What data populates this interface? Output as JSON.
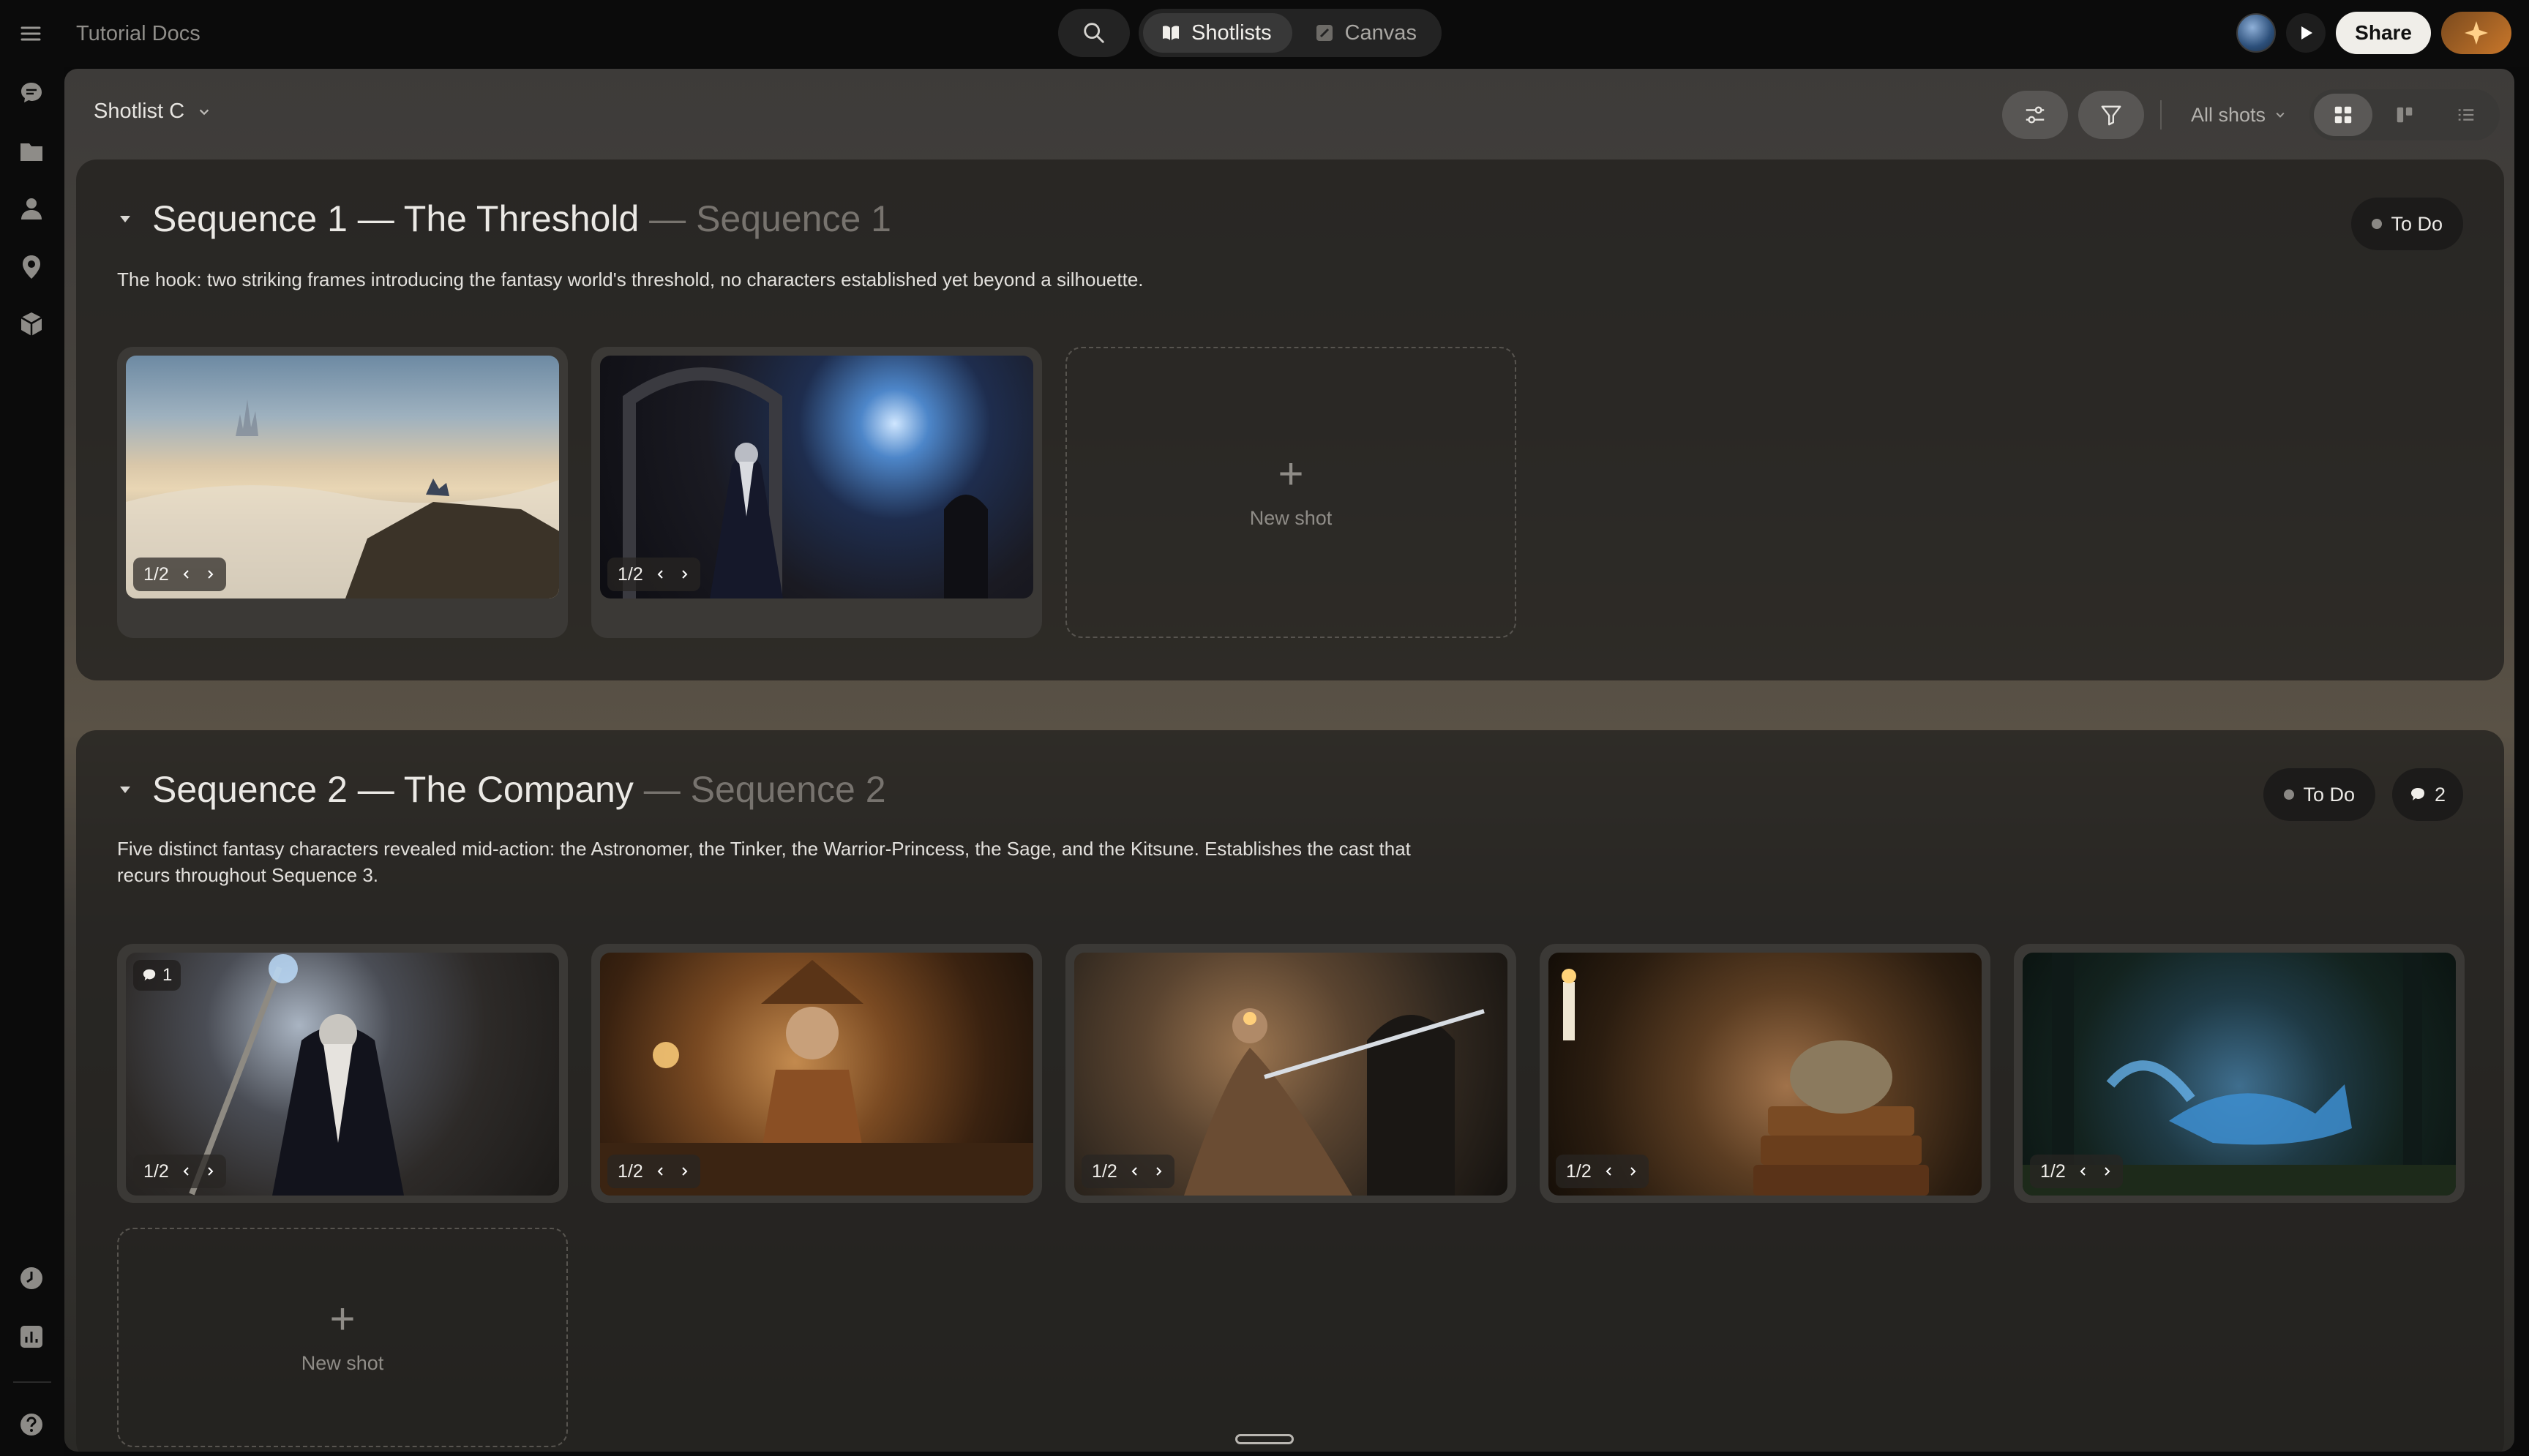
{
  "app": {
    "title": "Tutorial Docs"
  },
  "nav": {
    "tabs": [
      {
        "label": "Shotlists",
        "active": true
      },
      {
        "label": "Canvas",
        "active": false
      }
    ]
  },
  "header_actions": {
    "share_label": "Share"
  },
  "toolbar": {
    "shotlist_label": "Shotlist C",
    "filter_label": "All shots"
  },
  "sections": [
    {
      "title": "Sequence 1 — The Threshold",
      "subtitle": "— Sequence 1",
      "description": "The hook: two striking frames introducing the fantasy world's threshold, no characters established yet beyond a silhouette.",
      "status": "To Do",
      "shots": [
        {
          "counter": "1/2"
        },
        {
          "counter": "1/2"
        }
      ],
      "new_shot_label": "New shot"
    },
    {
      "title": "Sequence 2 — The Company",
      "subtitle": "— Sequence 2",
      "description": "Five distinct fantasy characters revealed mid-action: the Astronomer, the Tinker, the Warrior-Princess, the Sage, and the Kitsune. Establishes the cast that recurs throughout Sequence 3.",
      "status": "To Do",
      "comments": "2",
      "shots": [
        {
          "counter": "1/2",
          "comments": "1"
        },
        {
          "counter": "1/2"
        },
        {
          "counter": "1/2"
        },
        {
          "counter": "1/2"
        },
        {
          "counter": "1/2"
        }
      ],
      "new_shot_label": "New shot"
    }
  ]
}
